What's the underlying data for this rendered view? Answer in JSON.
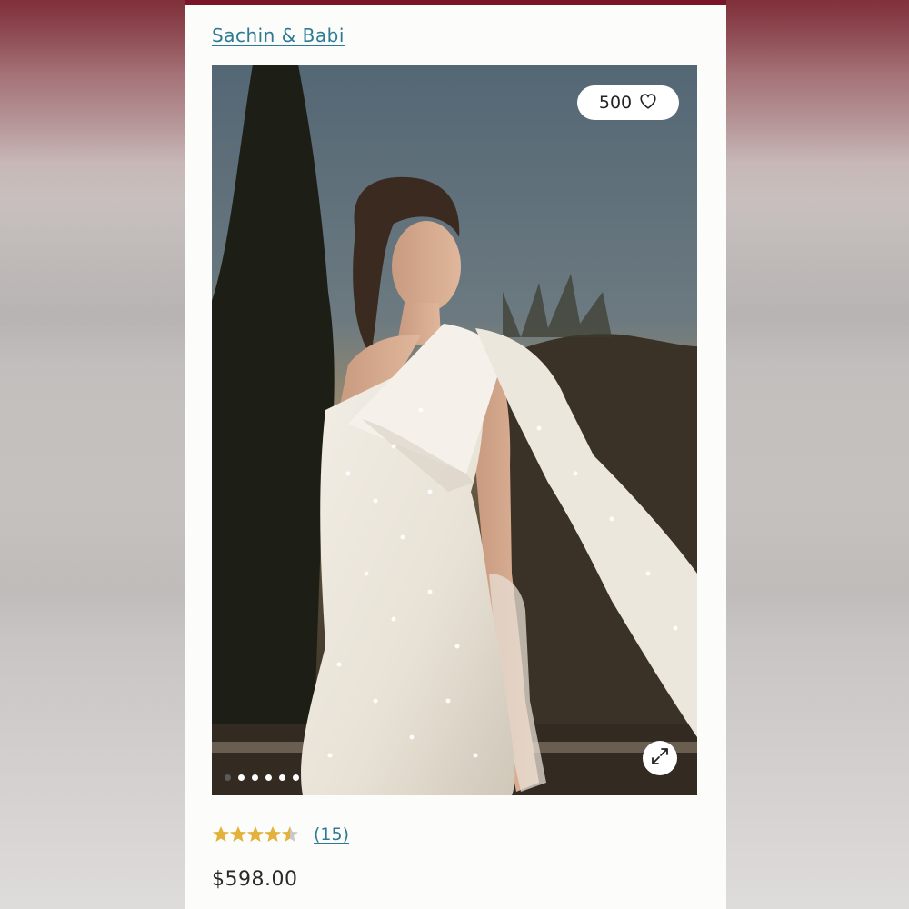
{
  "product": {
    "brand": "Sachin & Babi",
    "like_count": "500",
    "image": {
      "alt": "Model in white one-shoulder pearl-embellished mini dress with oversized bow",
      "slide_count": 6,
      "active_slide": 1
    },
    "rating": {
      "value": 4.5,
      "max": 5,
      "count_label": "(15)"
    },
    "price": "$598.00"
  },
  "icons": {
    "like": "heart-icon",
    "expand": "expand-icon",
    "star": "star-icon"
  },
  "colors": {
    "accent_bar": "#7a1428",
    "link": "#2c7a96",
    "star": "#e3b23c"
  }
}
